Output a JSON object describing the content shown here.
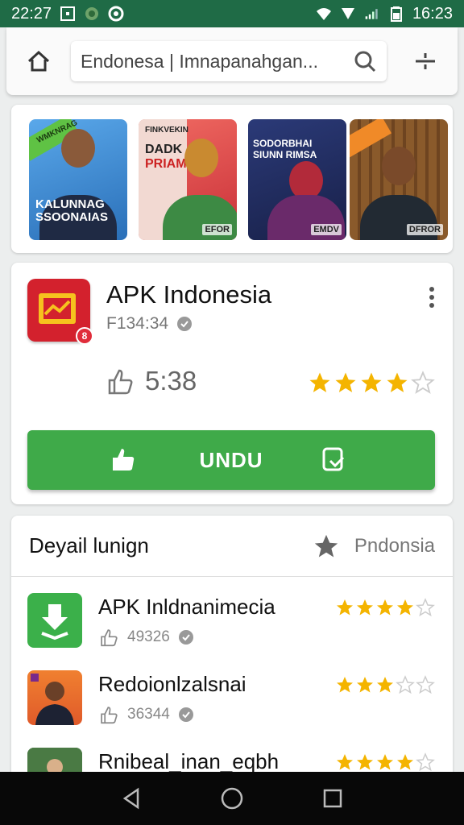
{
  "status_bar": {
    "time_left": "22:27",
    "time_right": "16:23"
  },
  "search": {
    "value": "Endonesa | Imnapanahgan..."
  },
  "banners": [
    {
      "line1": "KALUNNAG",
      "line2": "SSOONAIAS",
      "top_text": "WMKNRAG",
      "tag": "",
      "bg": "#3b8fdc",
      "shirt": "#1f2a44"
    },
    {
      "line1": "DADK",
      "line2": "PRIAM",
      "top_text": "FINKVEKIN",
      "tag": "EFOR",
      "bg": "#e8413f",
      "shirt": "#3d8a44"
    },
    {
      "line1": "SODORBHAI",
      "line2": "SIUNN RIMSA",
      "top_text": "",
      "tag": "EMDV",
      "bg": "#223066",
      "shirt": "#6a2a6a"
    },
    {
      "line1": "",
      "line2": "",
      "top_text": "",
      "tag": "DFROR",
      "bg": "#8a5a2b",
      "shirt": "#222a33"
    }
  ],
  "app": {
    "title": "APK Indonesia",
    "sub": "F134:34",
    "badge": "8",
    "likes": "5:38",
    "rating": 4,
    "download_label": "UNDU"
  },
  "details": {
    "title": "Deyail lunign",
    "right_label": "Pndonsia",
    "items": [
      {
        "name": "APK Inldnanimecia",
        "count": "49326",
        "rating": 4
      },
      {
        "name": "Redoionlzalsnai",
        "count": "36344",
        "rating": 3
      },
      {
        "name": "Rnibeal_inan_eqbh",
        "count": "",
        "rating": 4
      }
    ]
  },
  "colors": {
    "status_bar": "#1f6b46",
    "accent_green": "#3faa49",
    "star": "#f4b400",
    "app_icon": "#d3212d"
  }
}
